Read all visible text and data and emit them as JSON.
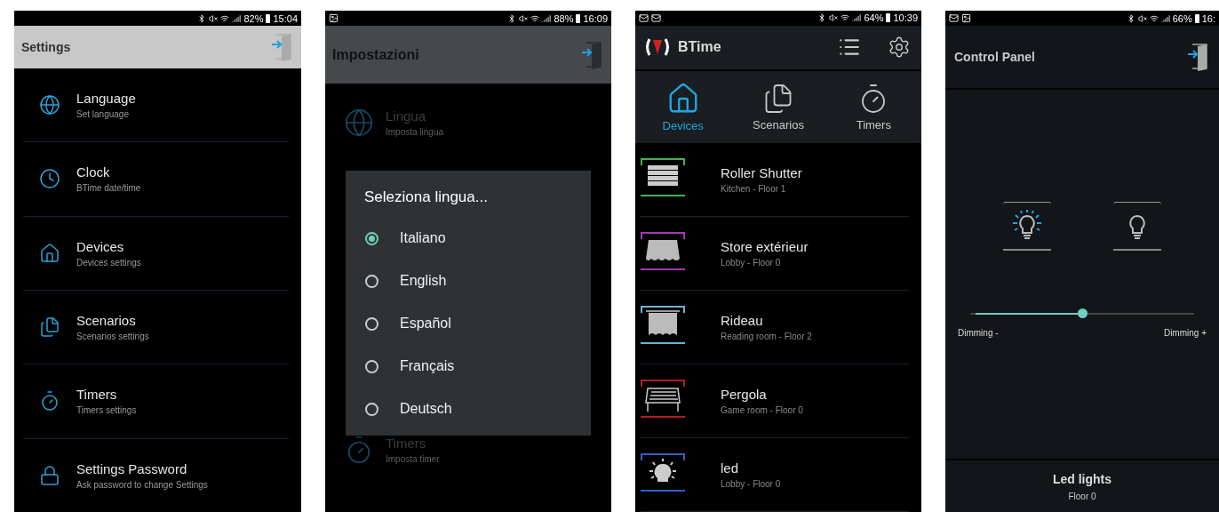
{
  "settings_screen": {
    "status": {
      "battery": "82%",
      "time": "15:04"
    },
    "title": "Settings",
    "items": [
      {
        "title": "Language",
        "subtitle": "Set language"
      },
      {
        "title": "Clock",
        "subtitle": "BTime date/time"
      },
      {
        "title": "Devices",
        "subtitle": "Devices settings"
      },
      {
        "title": "Scenarios",
        "subtitle": "Scenarios settings"
      },
      {
        "title": "Timers",
        "subtitle": "Timers settings"
      },
      {
        "title": "Settings Password",
        "subtitle": "Ask password to change Settings"
      }
    ]
  },
  "language_screen": {
    "status": {
      "battery": "88%",
      "time": "16:09"
    },
    "title": "Impostazioni",
    "background_items": [
      {
        "title": "Lingua",
        "subtitle": "Imposta lingua"
      },
      {
        "title": "Timers",
        "subtitle": "Imposta timer"
      }
    ],
    "dialog": {
      "title": "Seleziona lingua...",
      "options": [
        {
          "label": "Italiano",
          "selected": true
        },
        {
          "label": "English",
          "selected": false
        },
        {
          "label": "Español",
          "selected": false
        },
        {
          "label": "Français",
          "selected": false
        },
        {
          "label": "Deutsch",
          "selected": false
        }
      ]
    }
  },
  "devices_screen": {
    "status": {
      "battery": "64%",
      "time": "10:39"
    },
    "app_name": "BTime",
    "tabs": [
      {
        "label": "Devices",
        "selected": true
      },
      {
        "label": "Scenarios",
        "selected": false
      },
      {
        "label": "Timers",
        "selected": false
      }
    ],
    "devices": [
      {
        "name": "Roller Shutter",
        "location": "Kitchen - Floor  1",
        "color": "#4caf50"
      },
      {
        "name": "Store extérieur",
        "location": "Lobby - Floor  0",
        "color": "#a03cb0"
      },
      {
        "name": "Rideau",
        "location": "Reading room - Floor  2",
        "color": "#6ab4d4"
      },
      {
        "name": "Pergola",
        "location": "Game room - Floor  0",
        "color": "#b01e1e"
      },
      {
        "name": "led",
        "location": "Lobby - Floor  0",
        "color": "#3060c8"
      }
    ]
  },
  "control_panel_screen": {
    "status": {
      "battery": "66%",
      "time": "16:"
    },
    "title": "Control Panel",
    "lights": [
      {
        "on": true
      },
      {
        "on": false
      }
    ],
    "slider": {
      "level": 0.5,
      "min_label": "Dimming -",
      "max_label": "Dimming +"
    },
    "footer": {
      "name": "Led lights",
      "floor": "Floor  0"
    }
  }
}
